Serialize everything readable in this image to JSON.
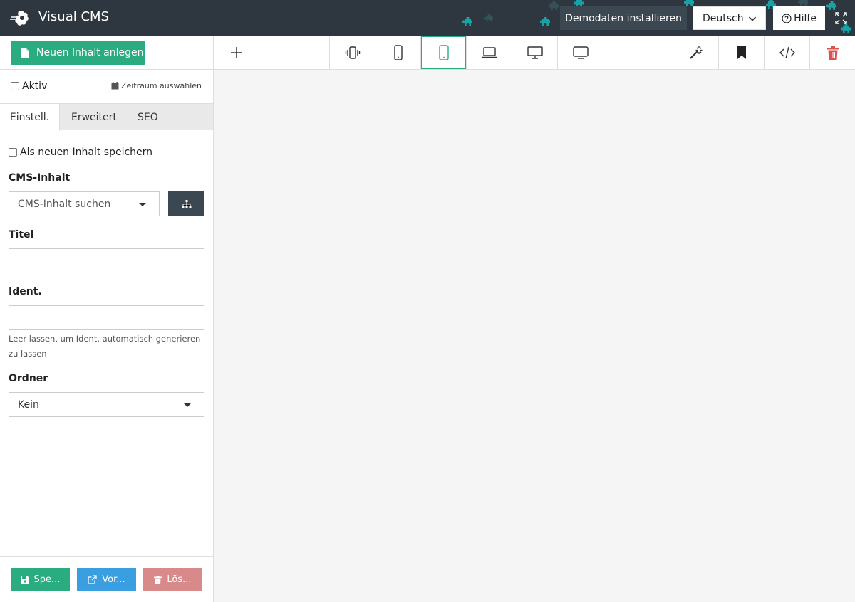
{
  "app": {
    "title": "Visual CMS"
  },
  "header": {
    "demo_button": "Demodaten installieren",
    "language": "Deutsch",
    "help_button": "Hilfe"
  },
  "sidebar": {
    "new_content_button": "Neuen Inhalt anlegen",
    "active_label": "Aktiv",
    "timerange_label": "Zeitraum auswählen",
    "tabs": [
      {
        "label": "Einstell.",
        "active": true
      },
      {
        "label": "Erweitert",
        "active": false
      },
      {
        "label": "SEO",
        "active": false
      }
    ],
    "save_as_new_label": "Als neuen Inhalt speichern",
    "cms_content": {
      "label": "CMS-Inhalt",
      "placeholder": "CMS-Inhalt suchen"
    },
    "title_field": {
      "label": "Titel",
      "value": ""
    },
    "ident_field": {
      "label": "Ident.",
      "value": "",
      "help": "Leer lassen, um Ident. automatisch generieren zu lassen"
    },
    "folder_field": {
      "label": "Ordner",
      "value": "Kein"
    },
    "footer": {
      "save_button": "Spe...",
      "preview_button": "Vor...",
      "delete_button": "Lös..."
    }
  },
  "toolbar": {
    "tools": [
      {
        "name": "add-icon"
      },
      {
        "name": "vibrate-phone-icon"
      },
      {
        "name": "phone-icon"
      },
      {
        "name": "tablet-icon",
        "active": true
      },
      {
        "name": "laptop-icon"
      },
      {
        "name": "desktop-icon"
      },
      {
        "name": "tv-icon"
      },
      {
        "name": "magic-wand-icon"
      },
      {
        "name": "bookmark-icon"
      },
      {
        "name": "code-icon"
      },
      {
        "name": "trash-icon"
      }
    ]
  },
  "colors": {
    "header_bg": "#2e363f",
    "accent_green": "#2bab80",
    "preview_blue": "#3a9fe0",
    "delete_red": "#d88a8a",
    "puzzle_teal": "#16a3a8"
  }
}
